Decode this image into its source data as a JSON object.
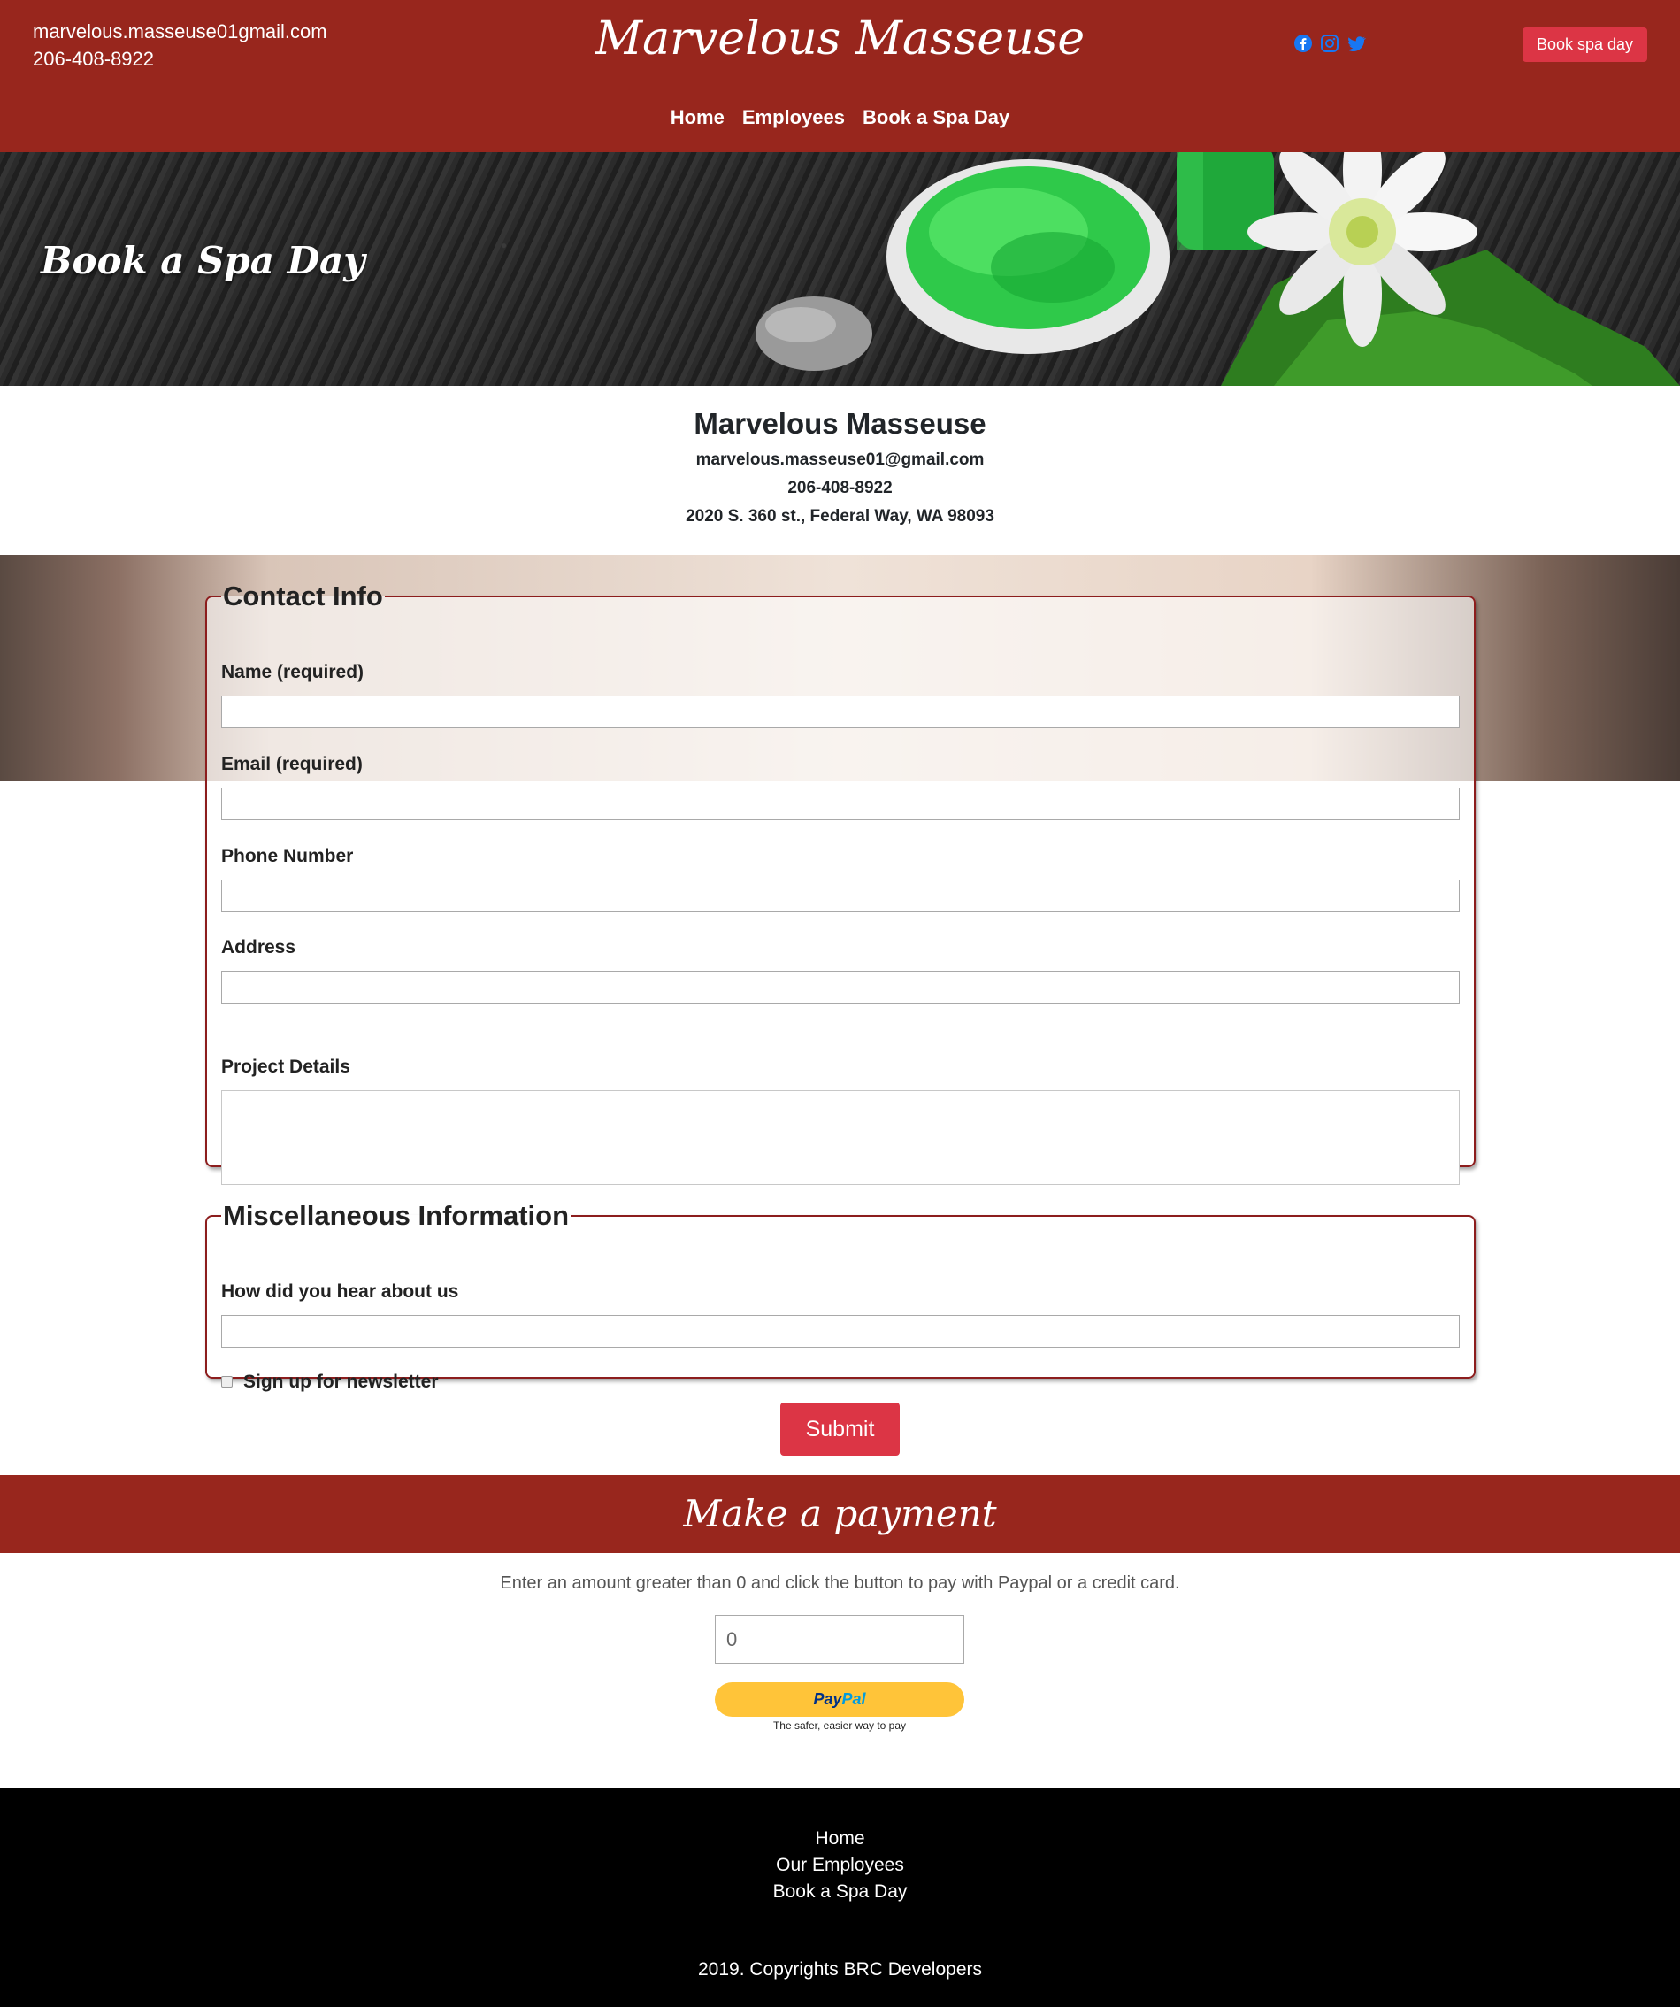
{
  "header": {
    "email": "marvelous.masseuse01gmail.com",
    "phone": "206-408-8922",
    "brand": "Marvelous Masseuse",
    "book_button": "Book spa day",
    "social_icons": [
      "facebook-icon",
      "instagram-icon",
      "twitter-icon"
    ],
    "nav": [
      "Home",
      "Employees",
      "Book a Spa Day"
    ]
  },
  "hero": {
    "title": "Book a Spa Day"
  },
  "business": {
    "name": "Marvelous Masseuse",
    "email": "marvelous.masseuse01@gmail.com",
    "phone": "206-408-8922",
    "address": "2020 S. 360 st., Federal Way, WA 98093"
  },
  "contact_form": {
    "legend": "Contact Info",
    "name_label": "Name (required)",
    "email_label": "Email (required)",
    "phone_label": "Phone Number",
    "address_label": "Address",
    "details_label": "Project Details"
  },
  "misc_form": {
    "legend": "Miscellaneous Information",
    "hear_label": "How did you hear about us",
    "newsletter_label": "Sign up for newsletter"
  },
  "submit_label": "Submit",
  "payment": {
    "title": "Make a payment",
    "instructions": "Enter an amount greater than 0 and click the button to pay with Paypal or a credit card.",
    "amount_value": "0",
    "paypal_text_1": "Pay",
    "paypal_text_2": "Pal",
    "paypal_tagline": "The safer, easier way to pay"
  },
  "footer": {
    "links": [
      "Home",
      "Our Employees",
      "Book a Spa Day"
    ],
    "copyright": "2019. Copyrights BRC Developers"
  },
  "colors": {
    "brand_red": "#98261d",
    "button_red": "#dc3545",
    "paypal_yellow": "#ffc439",
    "social_blue": "#1877f2"
  }
}
